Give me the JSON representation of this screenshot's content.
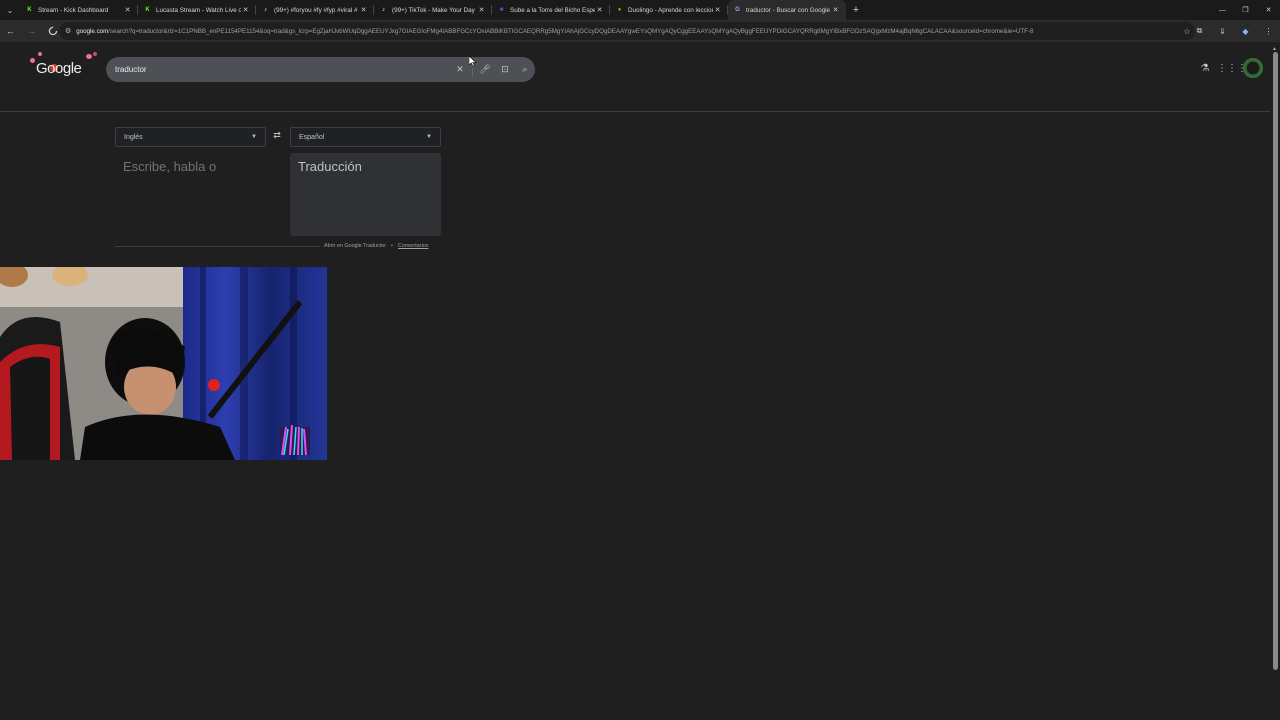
{
  "browser": {
    "tabs": [
      {
        "title": "Stream - Kick Dashboard",
        "favicon": "kick-icon",
        "color": "#53fc18",
        "glyph": "K",
        "active": false
      },
      {
        "title": "Lucasta Stream - Watch Live on Kick",
        "favicon": "kick-icon",
        "color": "#53fc18",
        "glyph": "K",
        "active": false
      },
      {
        "title": "(99+) #foryou #fy #fyp #viral #",
        "favicon": "tiktok-icon",
        "color": "#ffffff",
        "glyph": "♪",
        "active": false
      },
      {
        "title": "(99+) TikTok - Make Your Day",
        "favicon": "tiktok-icon",
        "color": "#ffffff",
        "glyph": "♪",
        "active": false
      },
      {
        "title": "Sube a la Torre del Bicho Espectral",
        "favicon": "game-icon",
        "color": "#3b5bdb",
        "glyph": "■",
        "active": false
      },
      {
        "title": "Duolingo - Aprende con lecciones",
        "favicon": "duolingo-icon",
        "color": "#58cc02",
        "glyph": "●",
        "active": false
      },
      {
        "title": "traductor - Buscar con Google",
        "favicon": "google-icon",
        "color": "#8ab4f8",
        "glyph": "G",
        "active": true
      }
    ],
    "url_host": "google.com",
    "url_rest": "/search?q=traductor&rlz=1C1PNBB_enPE1154PE1154&oq=trad&gs_lcrp=EgZjaHJvbWUqDggAEEUYJxg7GIAEGIoFMg4IABBFGCcYOxiABBiKBTIGCAEQRRg5MgYIAhAjGCcyDQgDEAAYgwEYsQMYgAQyCggEEAAYsQMYgAQyBggFEEUYPDIGCAYQRRg8MgYIBxBFGDzSAQgxMzM4ajBqN6gCALACAA&sourceid=chrome&ie=UTF-8"
  },
  "google": {
    "logo_text": "Google",
    "search_query": "traductor"
  },
  "translator": {
    "source_lang": "Inglés",
    "target_lang": "Español",
    "source_placeholder": "Escribe, habla o",
    "target_placeholder": "Traducción",
    "footer_link": "Abrir en Google Traductor",
    "footer_separator": "•",
    "feedback": "Comentarios"
  }
}
